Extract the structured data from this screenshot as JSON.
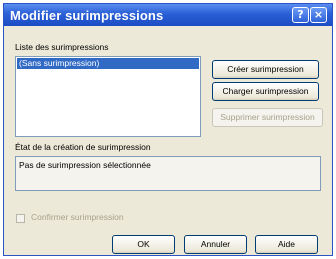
{
  "window": {
    "title": "Modifier surimpressions",
    "help_glyph": "?",
    "close_glyph": "×"
  },
  "list_section": {
    "label": "Liste des surimpressions",
    "items": [
      "(Sans surimpression)"
    ],
    "selected_index": 0
  },
  "side_buttons": {
    "create": "Créer surimpression",
    "load": "Charger surimpression",
    "delete": "Supprimer surimpression"
  },
  "status_section": {
    "label": "État de la création de surimpression",
    "text": "Pas de surimpression sélectionnée"
  },
  "confirm": {
    "label": "Confirmer surimpression",
    "checked": false,
    "enabled": false
  },
  "footer_buttons": {
    "ok": "OK",
    "cancel": "Annuler",
    "help": "Aide"
  },
  "colors": {
    "title_bar": "#2a5fd6",
    "selection": "#316ac5",
    "dialog_bg": "#ece9d8"
  }
}
